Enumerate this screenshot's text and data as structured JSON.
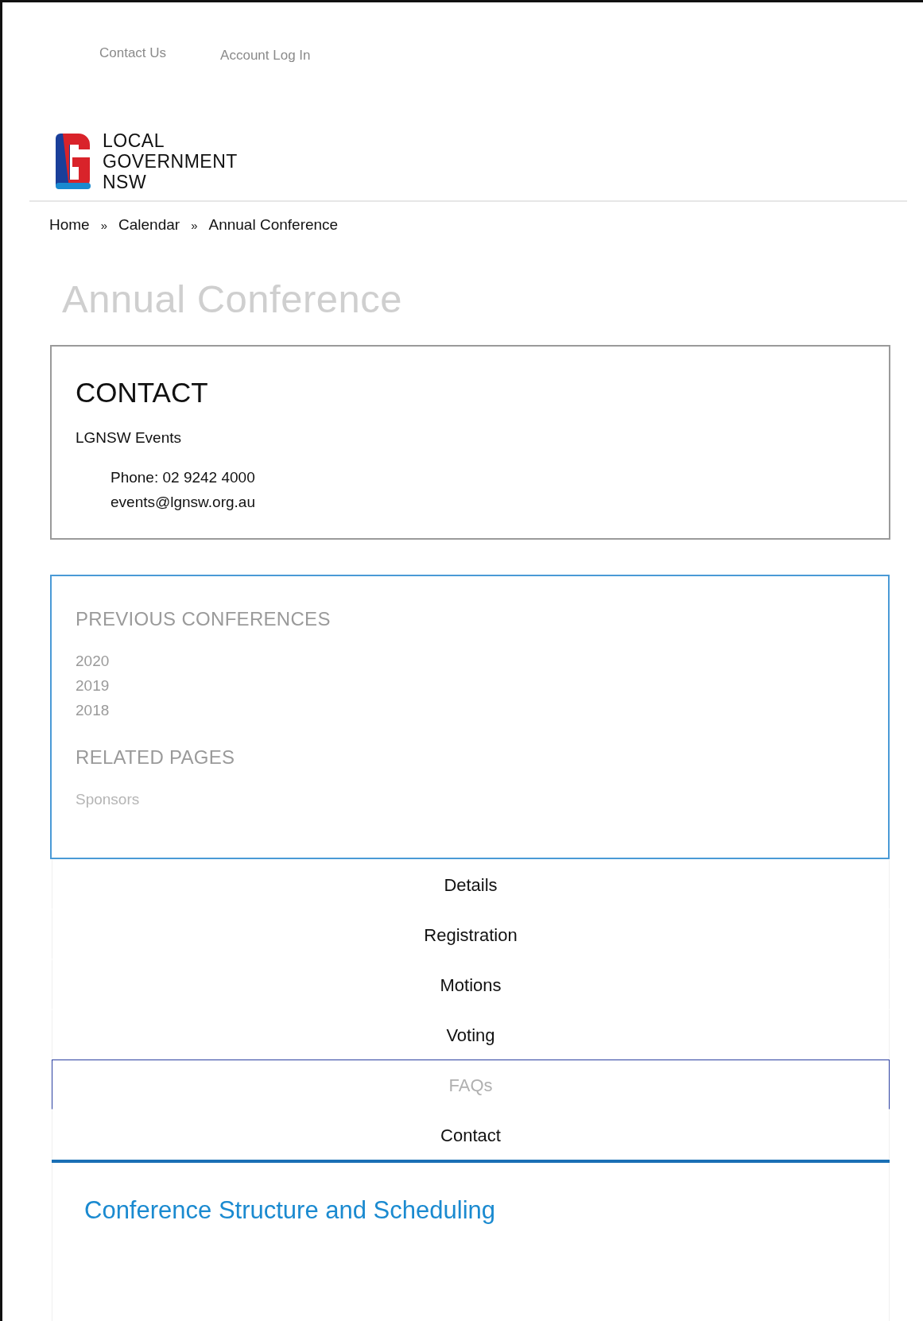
{
  "top_links": [
    "Contact Us",
    "Account Log In"
  ],
  "logo": {
    "lines": [
      "LOCAL",
      "GOVERNMENT",
      "NSW"
    ]
  },
  "breadcrumb": [
    "Home",
    "Calendar",
    "Annual Conference"
  ],
  "breadcrumb_separator": "»",
  "page_title": "Annual Conference",
  "contact": {
    "heading": "CONTACT",
    "name": "LGNSW Events",
    "phone": "Phone: 02 9242 4000",
    "email": "events@lgnsw.org.au"
  },
  "sidebar": {
    "sections": [
      {
        "heading": "PREVIOUS CONFERENCES",
        "links": [
          "2020",
          "2019",
          "2018"
        ]
      },
      {
        "heading": "RELATED PAGES",
        "links": [
          "Sponsors"
        ]
      }
    ]
  },
  "tabs": [
    {
      "label": "Details",
      "selected": false
    },
    {
      "label": "Registration",
      "selected": false
    },
    {
      "label": "Motions",
      "selected": false
    },
    {
      "label": "Voting",
      "selected": false
    },
    {
      "label": "FAQs",
      "selected": true
    },
    {
      "label": "Contact",
      "selected": false
    }
  ],
  "section_heading": "Conference Structure and Scheduling"
}
